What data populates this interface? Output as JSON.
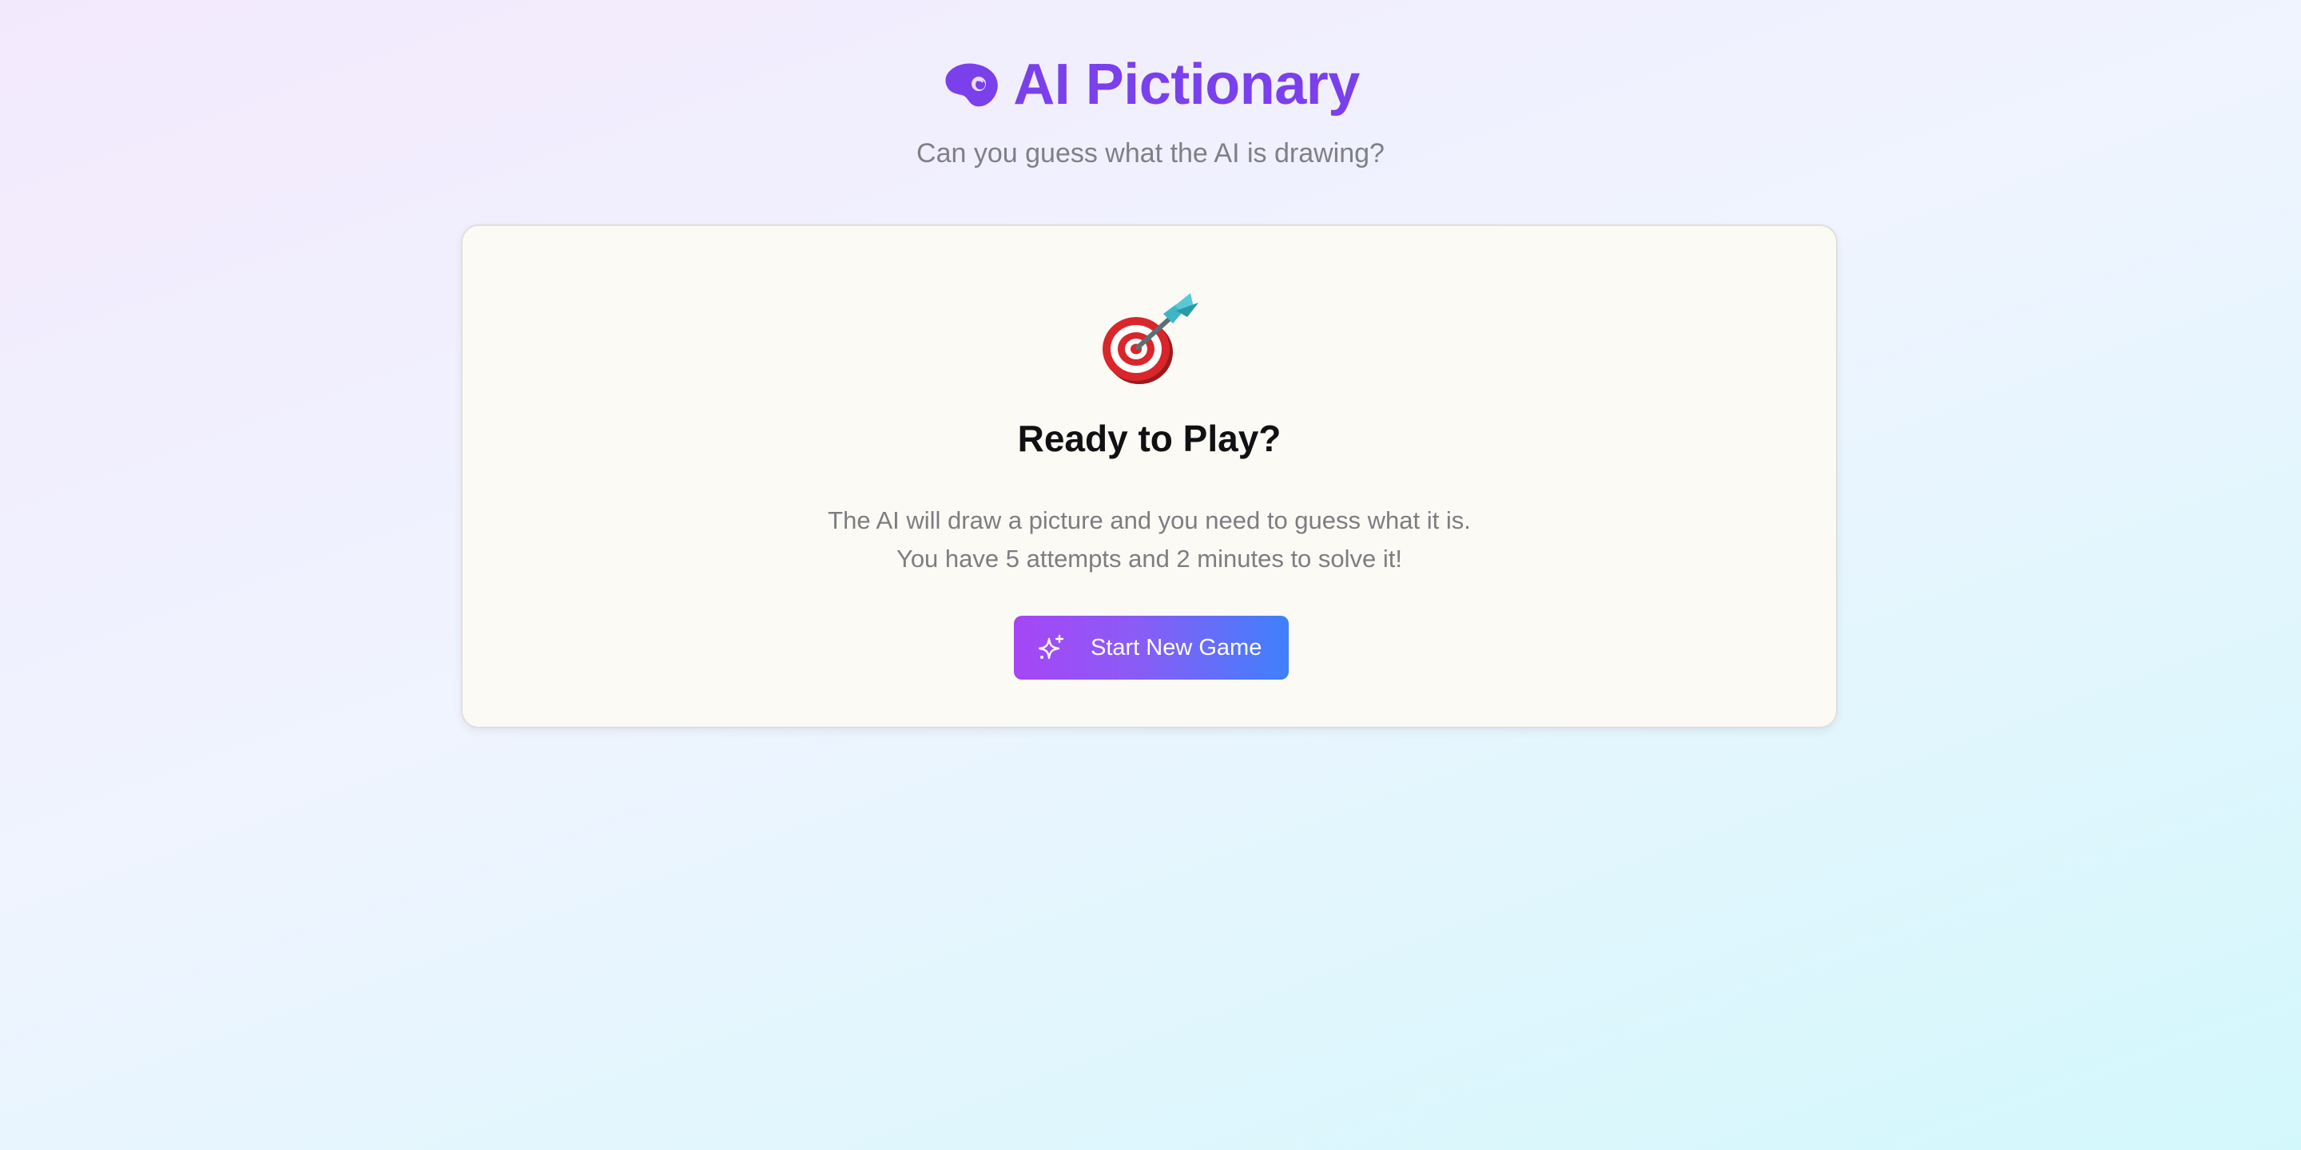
{
  "header": {
    "icon": "palette-icon",
    "title": "AI Pictionary",
    "subtitle": "Can you guess what the AI is drawing?"
  },
  "card": {
    "icon": "target-dart-icon",
    "title": "Ready to Play?",
    "description_lines": [
      "The AI will draw a picture and you need to guess what it is.",
      "You have 5 attempts and 2 minutes to solve it!"
    ],
    "start_button": {
      "icon": "sparkles-icon",
      "label": "Start New Game"
    }
  },
  "colors": {
    "title": "#7a40ec",
    "button_gradient_start": "#a646f6",
    "button_gradient_end": "#3f80fb",
    "card_background": "#fbfaf5"
  }
}
